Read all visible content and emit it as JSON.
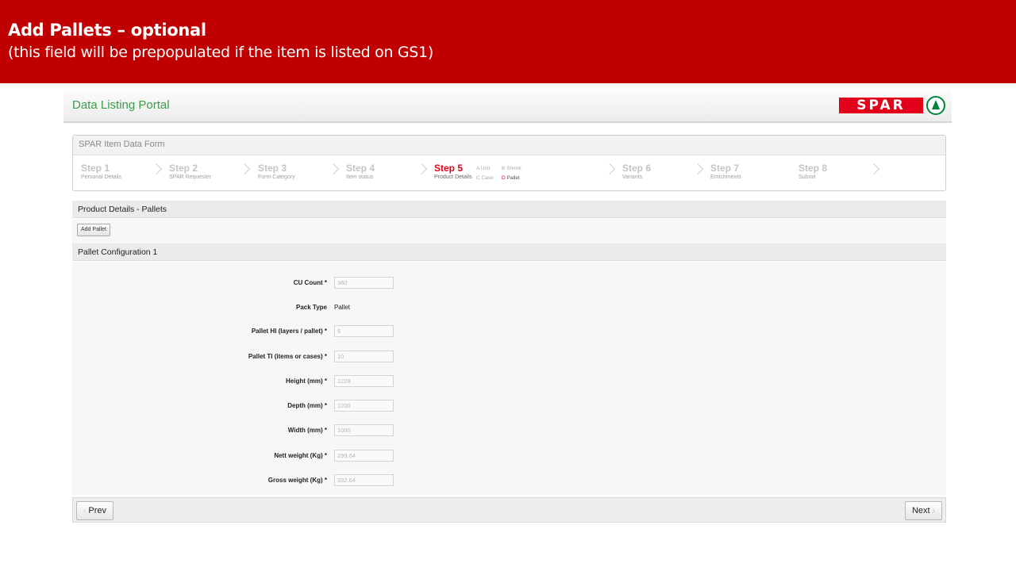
{
  "banner": {
    "title": "Add Pallets – optional",
    "subtitle": "(this field will be prepopulated if the item is listed on GS1)"
  },
  "header": {
    "portal_title": "Data Listing Portal",
    "logo_text": "SPAR"
  },
  "form": {
    "title": "SPAR Item Data Form",
    "steps": [
      {
        "title": "Step 1",
        "sub": "Personal Details"
      },
      {
        "title": "Step 2",
        "sub": "SPAR Requester"
      },
      {
        "title": "Step 3",
        "sub": "Form Category"
      },
      {
        "title": "Step 4",
        "sub": "Item status"
      },
      {
        "title": "Step 5",
        "sub": "Product Details"
      },
      {
        "title": "Step 6",
        "sub": "Variants"
      },
      {
        "title": "Step 7",
        "sub": "Enrichments"
      },
      {
        "title": "Step 8",
        "sub": "Submit"
      }
    ],
    "step5_options": [
      {
        "letter": "A",
        "label": "Unit"
      },
      {
        "letter": "B",
        "label": "Shrink"
      },
      {
        "letter": "C",
        "label": "Case"
      },
      {
        "letter": "D",
        "label": "Pallet"
      }
    ]
  },
  "section": {
    "title": "Product Details - Pallets",
    "add_button": "Add Pallet",
    "config_title": "Pallet Configuration 1"
  },
  "fields": [
    {
      "label": "CU Count *",
      "value": "360"
    },
    {
      "label": "Pack Type",
      "value": "Pallet"
    },
    {
      "label": "Pallet HI (layers / pallet) *",
      "value": "6"
    },
    {
      "label": "Pallet TI (items or cases) *",
      "value": "10"
    },
    {
      "label": "Height (mm) *",
      "value": "1228"
    },
    {
      "label": "Depth (mm) *",
      "value": "1200"
    },
    {
      "label": "Width (mm) *",
      "value": "1000"
    },
    {
      "label": "Nett weight (Kg) *",
      "value": "299.64"
    },
    {
      "label": "Gross weight (Kg) *",
      "value": "332.64"
    }
  ],
  "nav": {
    "prev": "Prev",
    "next": "Next"
  },
  "colors": {
    "banner": "#c00000",
    "spar_red": "#e2001a",
    "spar_green": "#00843d",
    "portal_title": "#3a9d4a"
  }
}
